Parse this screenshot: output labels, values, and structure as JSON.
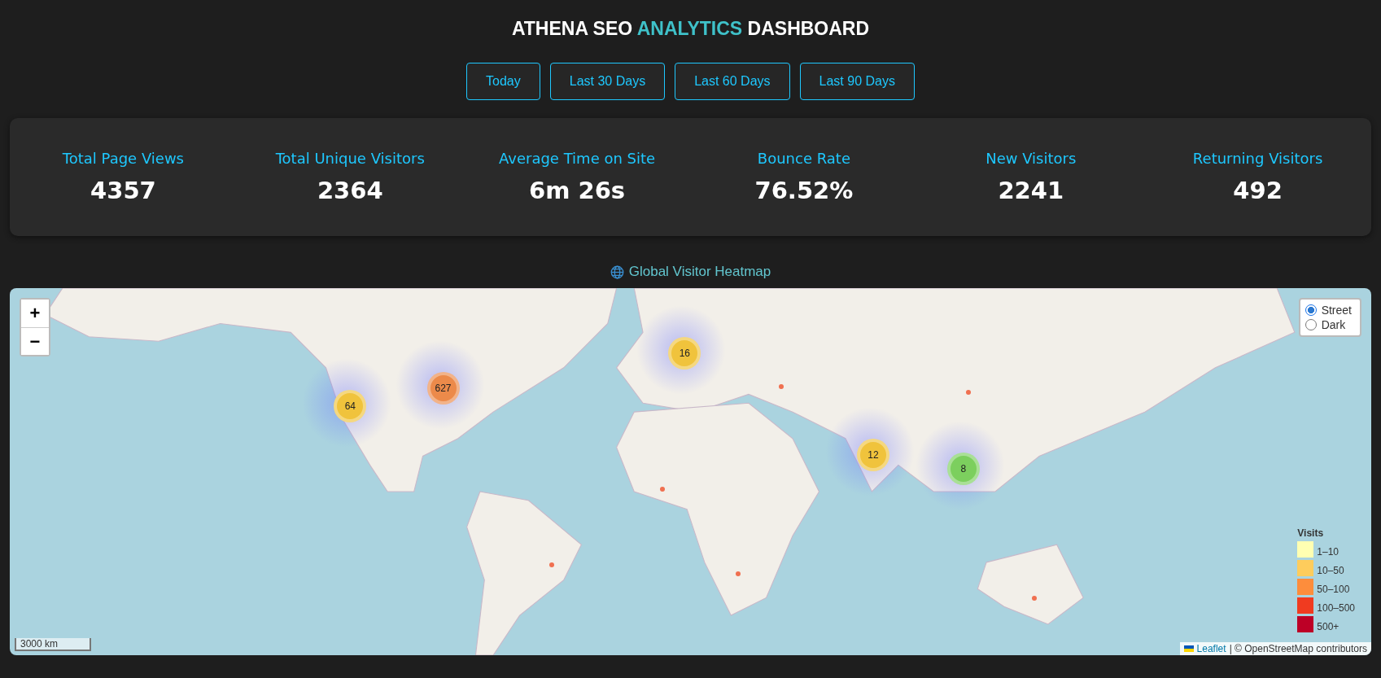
{
  "title": [
    {
      "text": "ATHENA SEO",
      "accent": false
    },
    {
      "text": "ANALYTICS",
      "accent": true
    },
    {
      "text": "DASHBOARD",
      "accent": false
    }
  ],
  "range_buttons": [
    "Today",
    "Last 30 Days",
    "Last 60 Days",
    "Last 90 Days"
  ],
  "stats": [
    {
      "label": "Total Page Views",
      "value": "4357"
    },
    {
      "label": "Total Unique Visitors",
      "value": "2364"
    },
    {
      "label": "Average Time on Site",
      "value": "6m 26s"
    },
    {
      "label": "Bounce Rate",
      "value": "76.52%"
    },
    {
      "label": "New Visitors",
      "value": "2241"
    },
    {
      "label": "Returning Visitors",
      "value": "492"
    }
  ],
  "map_heading": "Global Visitor Heatmap",
  "map": {
    "zoom_buttons": [
      "+",
      "−"
    ],
    "layers": [
      {
        "label": "Street",
        "selected": true
      },
      {
        "label": "Dark",
        "selected": false
      }
    ],
    "clusters": [
      {
        "count": "64",
        "color": "#f0c33c"
      },
      {
        "count": "627",
        "color": "#ec8a4a"
      },
      {
        "count": "16",
        "color": "#f0c33c"
      },
      {
        "count": "12",
        "color": "#f0c33c"
      },
      {
        "count": "8",
        "color": "#7ccf5e"
      }
    ],
    "legend": {
      "title": "Visits",
      "items": [
        {
          "label": "1–10",
          "color": "#ffffb2"
        },
        {
          "label": "10–50",
          "color": "#fecc5c"
        },
        {
          "label": "50–100",
          "color": "#fd8d3c"
        },
        {
          "label": "100–500",
          "color": "#f03b20"
        },
        {
          "label": "500+",
          "color": "#bd0026"
        }
      ]
    },
    "scale": "3000 km",
    "attribution": {
      "link": "Leaflet",
      "text": "| © OpenStreetMap contributors"
    }
  }
}
